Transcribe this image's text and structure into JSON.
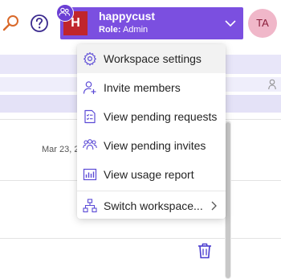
{
  "header": {
    "workspace": {
      "initial": "H",
      "name": "happycust",
      "role_label": "Role:",
      "role_value": "Admin"
    },
    "user": {
      "initials": "TA"
    },
    "colors": {
      "workspace_bg": "#7b4fe0",
      "workspace_avatar": "#c0252c",
      "accent_icon": "#6b3fd4"
    }
  },
  "background": {
    "date": "Mar 23, 2"
  },
  "menu": {
    "items": [
      {
        "label": "Workspace settings",
        "icon": "gear-icon",
        "active": true
      },
      {
        "label": "Invite members",
        "icon": "person-add-icon"
      },
      {
        "label": "View pending requests",
        "icon": "document-checklist-icon"
      },
      {
        "label": "View pending invites",
        "icon": "people-icon"
      },
      {
        "label": "View usage report",
        "icon": "chart-icon"
      },
      {
        "label": "Switch workspace...",
        "icon": "org-chart-icon",
        "has_submenu": true
      }
    ]
  }
}
